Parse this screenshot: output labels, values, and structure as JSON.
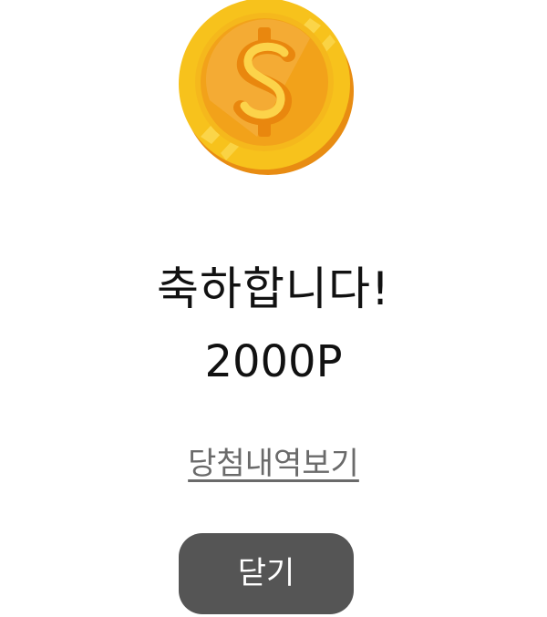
{
  "dialog": {
    "title": "축하합니다!",
    "amount": "2000P",
    "history_link": "당첨내역보기",
    "close_label": "닫기"
  },
  "icons": {
    "coin": "dollar-coin-icon"
  },
  "colors": {
    "coin_outer": "#F7C21C",
    "coin_inner": "#F2A21A",
    "coin_rim_shadow": "#E88C12",
    "button_bg": "#555555",
    "link_text": "#6A6A6A"
  }
}
